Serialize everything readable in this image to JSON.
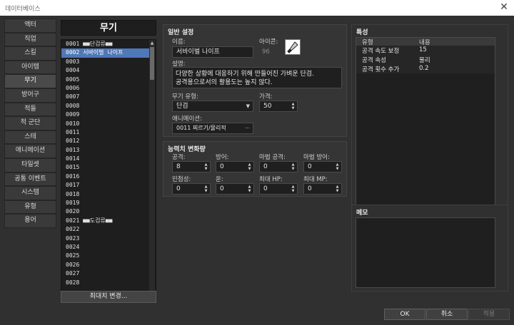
{
  "window": {
    "title": "데이터베이스"
  },
  "nav": {
    "items": [
      "액터",
      "직업",
      "스킬",
      "아이템",
      "무기",
      "방어구",
      "적들",
      "적 군단",
      "스테",
      "애니메이션",
      "타일셋",
      "공통 이벤트",
      "시스템",
      "유형",
      "용어"
    ],
    "active_index": 4
  },
  "list": {
    "header": "무기",
    "rows": [
      "0001 ■■단검류■■",
      "0002 서바이벌 나이프",
      "0003",
      "0004",
      "0005",
      "0006",
      "0007",
      "0008",
      "0009",
      "0010",
      "0011",
      "0012",
      "0013",
      "0014",
      "0015",
      "0016",
      "0017",
      "0018",
      "0019",
      "0020",
      "0021 ■■도검류■■",
      "0022",
      "0023",
      "0024",
      "0025",
      "0026",
      "0027",
      "0028"
    ],
    "selected_index": 1,
    "max_button": "최대치 변경..."
  },
  "general": {
    "title": "일반 설정",
    "name_label": "이름:",
    "name_value": "서바이벌 나이프",
    "icon_label": "아이콘:",
    "icon_index": "96",
    "icon_name": "knife-icon",
    "desc_label": "설명:",
    "desc_line1": "다양한 상황에 대응하기 위해 만들어진 가벼운 단검.",
    "desc_line2": "공격용으로서의 활용도는 높지 않다.",
    "type_label": "무기 유형:",
    "type_value": "단검",
    "price_label": "가격:",
    "price_value": "50",
    "anim_label": "애니메이션:",
    "anim_value": "0011 찌르기/물리적",
    "anim_button": "···"
  },
  "params": {
    "title": "능력치 변화량",
    "labels": [
      "공격:",
      "방어:",
      "마법 공격:",
      "마법 방어:",
      "민첩성:",
      "운:",
      "최대 HP:",
      "최대 MP:"
    ],
    "values": [
      "8",
      "0",
      "0",
      "0",
      "0",
      "0",
      "0",
      "0"
    ]
  },
  "traits": {
    "title": "특성",
    "col_type": "유형",
    "col_content": "내용",
    "rows": [
      {
        "type": "공격 속도 보정",
        "content": "15"
      },
      {
        "type": "공격 속성",
        "content": "물리"
      },
      {
        "type": "공격 횟수 추가",
        "content": "0.2"
      }
    ]
  },
  "memo": {
    "title": "메모"
  },
  "footer": {
    "ok": "OK",
    "cancel": "취소",
    "apply": "적용"
  },
  "colors": {
    "accent": "#4f78b8",
    "panel": "#353535",
    "field": "#1f1f1f"
  }
}
